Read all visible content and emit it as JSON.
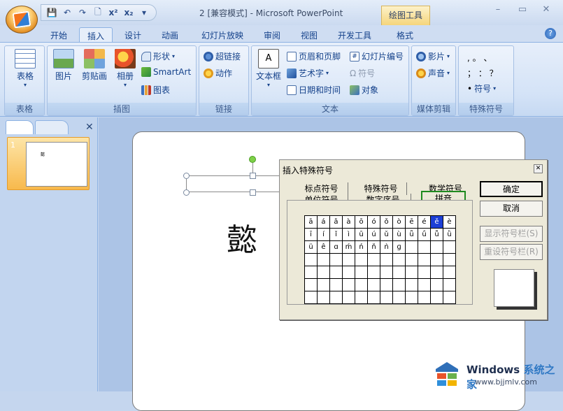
{
  "window": {
    "title": "2 [兼容模式] - Microsoft PowerPoint",
    "context_tab": "绘图工具",
    "controls": [
      "–",
      "▭",
      "✕"
    ]
  },
  "tabs": [
    "开始",
    "插入",
    "设计",
    "动画",
    "幻灯片放映",
    "审阅",
    "视图",
    "开发工具",
    "格式"
  ],
  "active_tab": "插入",
  "ribbon": {
    "groups": {
      "table": {
        "label": "表格",
        "button": "表格"
      },
      "illustrations": {
        "label": "插图",
        "picture": "图片",
        "clipart": "剪贴画",
        "album": "相册",
        "shapes": "形状",
        "smartart": "SmartArt",
        "chart": "图表"
      },
      "links": {
        "label": "链接",
        "hyperlink": "超链接",
        "action": "动作"
      },
      "text": {
        "label": "文本",
        "textbox": "文本框",
        "header_footer": "页眉和页脚",
        "wordart": "艺术字",
        "datetime": "日期和时间",
        "slide_number": "幻灯片编号",
        "symbol": "符号",
        "object": "对象"
      },
      "media": {
        "label": "媒体剪辑",
        "movie": "影片",
        "sound": "声音"
      },
      "special": {
        "label": "特殊符号",
        "row1": ",  。 、",
        "row2": "；  ：  ？",
        "symbol_btn": "符号"
      }
    }
  },
  "slides_pane": {
    "slide_number": "1",
    "thumb_char": "懿"
  },
  "slide": {
    "char": "懿"
  },
  "dialog": {
    "title": "插入特殊符号",
    "close": "☒",
    "tabs_row1": [
      "标点符号",
      "特殊符号",
      "数学符号"
    ],
    "tabs_row2": [
      "单位符号",
      "数字序号",
      "拼音"
    ],
    "active_tab": "拼音",
    "grid": [
      [
        "ā",
        "á",
        "ǎ",
        "à",
        "ō",
        "ó",
        "ǒ",
        "ò",
        "ē",
        "é",
        "ě",
        "è"
      ],
      [
        "ī",
        "í",
        "ǐ",
        "ì",
        "ū",
        "ú",
        "ǔ",
        "ù",
        "ǖ",
        "ǘ",
        "ǚ",
        "ǜ"
      ],
      [
        "ü",
        "ê",
        "ɑ",
        "ḿ",
        "ń",
        "ň",
        "ǹ",
        "ɡ",
        "",
        "",
        "",
        ""
      ],
      [
        "",
        "",
        "",
        "",
        "",
        "",
        "",
        "",
        "",
        "",
        "",
        ""
      ],
      [
        "",
        "",
        "",
        "",
        "",
        "",
        "",
        "",
        "",
        "",
        "",
        ""
      ],
      [
        "",
        "",
        "",
        "",
        "",
        "",
        "",
        "",
        "",
        "",
        "",
        ""
      ],
      [
        "",
        "",
        "",
        "",
        "",
        "",
        "",
        "",
        "",
        "",
        "",
        ""
      ]
    ],
    "selected": "ě",
    "buttons": {
      "ok": "确定",
      "cancel": "取消",
      "show_bar": "显示符号栏(S)",
      "reset_bar": "重设符号栏(R)"
    }
  },
  "watermark": {
    "brand": "Windows",
    "brand_cn": "系统之家",
    "url": "www.bjjmlv.com"
  },
  "colors": {
    "accent": "#15428b",
    "ribbon": "#d4e3f7",
    "selection": "#1c3fd6",
    "highlight_border": "#1f8a1f"
  }
}
